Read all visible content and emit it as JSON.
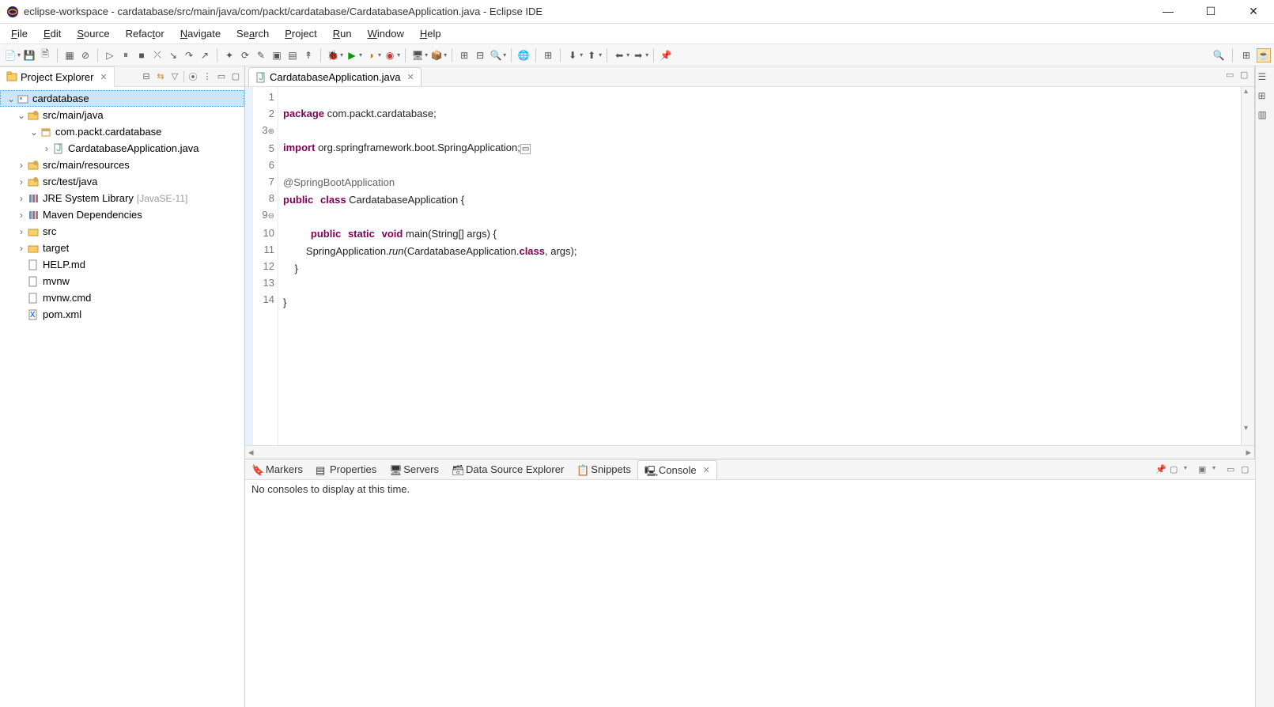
{
  "window": {
    "title": "eclipse-workspace - cardatabase/src/main/java/com/packt/cardatabase/CardatabaseApplication.java - Eclipse IDE"
  },
  "menubar": [
    "File",
    "Edit",
    "Source",
    "Refactor",
    "Navigate",
    "Search",
    "Project",
    "Run",
    "Window",
    "Help"
  ],
  "project_explorer": {
    "title": "Project Explorer",
    "tree": {
      "root": "cardatabase",
      "src_main_java": "src/main/java",
      "package": "com.packt.cardatabase",
      "app_file": "CardatabaseApplication.java",
      "src_main_resources": "src/main/resources",
      "src_test_java": "src/test/java",
      "jre": "JRE System Library",
      "jre_decor": "[JavaSE-11]",
      "maven": "Maven Dependencies",
      "src": "src",
      "target": "target",
      "help_md": "HELP.md",
      "mvnw": "mvnw",
      "mvnw_cmd": "mvnw.cmd",
      "pom_xml": "pom.xml"
    }
  },
  "editor": {
    "tab": "CardatabaseApplication.java",
    "line_numbers": [
      "1",
      "2",
      "3",
      "5",
      "6",
      "7",
      "8",
      "9",
      "10",
      "11",
      "12",
      "13",
      "14"
    ],
    "code": {
      "l1_kw": "package",
      "l1_rest": " com.packt.cardatabase;",
      "l3_kw": "import",
      "l3_rest": " org.springframework.boot.SpringApplication;",
      "l3_collapsed": "▭",
      "l6": "@SpringBootApplication",
      "l7_kw1": "public",
      "l7_kw2": "class",
      "l7_name": " CardatabaseApplication {",
      "l9_kw1": "public",
      "l9_kw2": "static",
      "l9_kw3": "void",
      "l9_rest": " main(String[] args) {",
      "l10a": "        SpringApplication.",
      "l10m": "run",
      "l10b": "(CardatabaseApplication.",
      "l10c": "class",
      "l10d": ", args);",
      "l11": "    }",
      "l13": "}"
    }
  },
  "bottom": {
    "tabs": [
      "Markers",
      "Properties",
      "Servers",
      "Data Source Explorer",
      "Snippets",
      "Console"
    ],
    "message": "No consoles to display at this time."
  }
}
